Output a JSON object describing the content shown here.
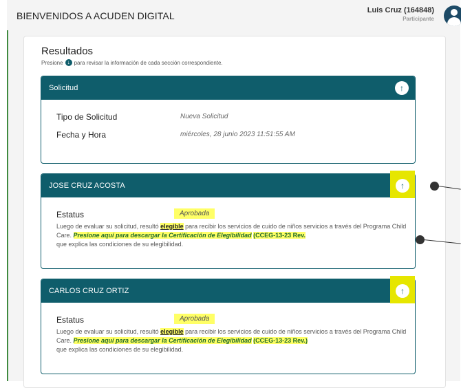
{
  "header": {
    "title": "BIENVENIDOS A ACUDEN DIGITAL",
    "user_name": "Luis Cruz (164848)",
    "user_role": "Participante"
  },
  "results": {
    "title": "Resultados",
    "hint_before": "Presione",
    "hint_after": "para revisar la información de cada sección correspondiente."
  },
  "solicitud": {
    "title": "Solicitud",
    "rows": [
      {
        "label": "Tipo de Solicitud",
        "value": "Nueva Solicitud"
      },
      {
        "label": "Fecha y Hora",
        "value": "miércoles, 28 junio 2023 11:51:55 AM"
      }
    ]
  },
  "participants": [
    {
      "name": "JOSE CRUZ ACOSTA",
      "status_label": "Estatus",
      "status_value": "Aprobada",
      "desc_1": "Luego de evaluar su solicitud, resultó",
      "desc_elegible": "elegible",
      "desc_2": "para recibir los servicios de cuido de niños servicios a través del Programa Child Care.",
      "link_text": "Presione aquí para descargar la Certificación de Elegibilidad",
      "code": "(CCEG-13-23 Rev.",
      "desc_3": "que explica las condiciones de su elegibilidad."
    },
    {
      "name": "CARLOS CRUZ ORTIZ",
      "status_label": "Estatus",
      "status_value": "Aprobada",
      "desc_1": "Luego de evaluar su solicitud, resultó",
      "desc_elegible": "elegible",
      "desc_2": "para recibir los servicios de cuido de niños servicios a través del Programa Child Care.",
      "link_text": "Presione aquí para descargar la Certificación de Elegibilidad",
      "code": "(CCEG-13-23 Rev.)",
      "desc_3": "que explica las condiciones de su elegibilidad."
    }
  ],
  "icons": {
    "toggle": "arrow-up-circle-icon",
    "hint": "arrow-down-circle-icon",
    "avatar": "user-avatar-icon"
  },
  "colors": {
    "primary": "#0f5d6b",
    "highlight": "#ffff66",
    "link": "#1d6a2b"
  }
}
